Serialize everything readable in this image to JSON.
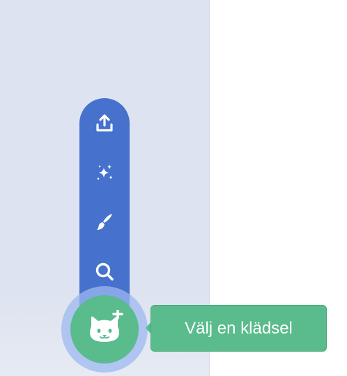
{
  "sprite_menu": {
    "items": [
      {
        "icon": "upload-icon"
      },
      {
        "icon": "surprise-icon"
      },
      {
        "icon": "paint-icon"
      },
      {
        "icon": "search-icon"
      }
    ],
    "main_button_icon": "cat-plus-icon",
    "tooltip": "Välj en klädsel"
  },
  "colors": {
    "stage_background": "#dde3f0",
    "menu_blue": "#4672cd",
    "action_green": "#5abb8c",
    "halo": "#9db8f0"
  }
}
